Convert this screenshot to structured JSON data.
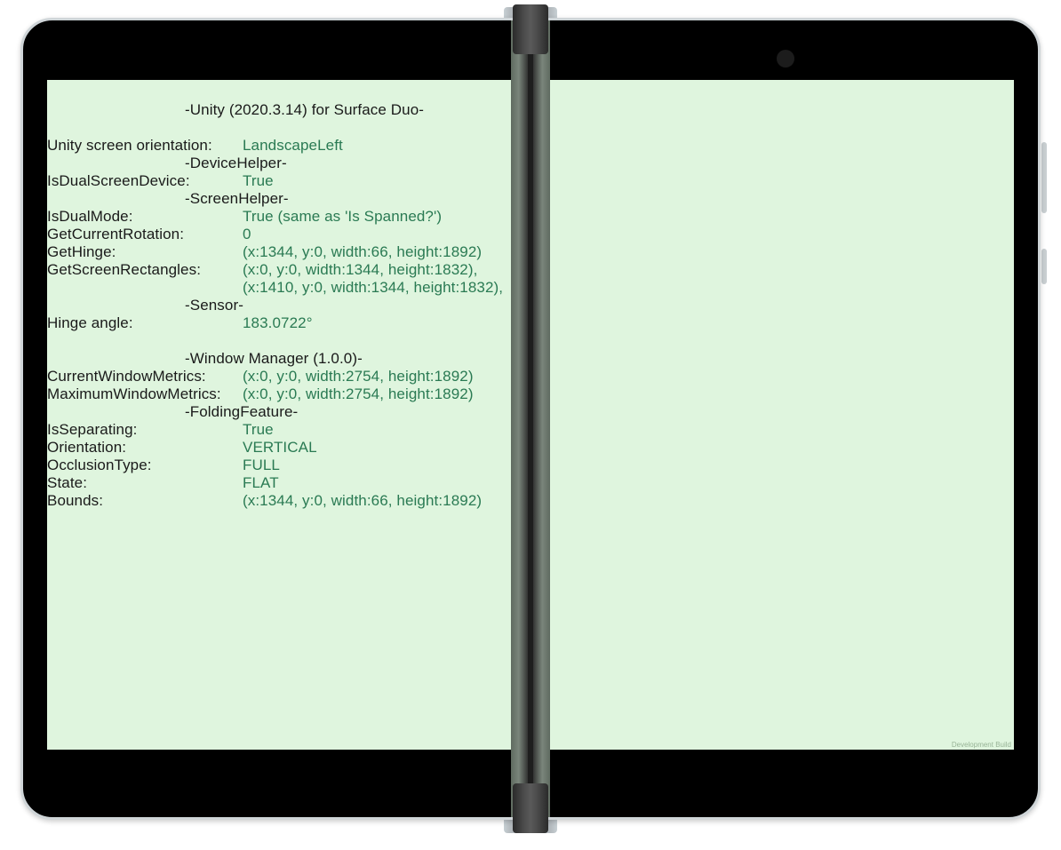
{
  "title": "-Unity (2020.3.14) for Surface Duo-",
  "orientation": {
    "label": "Unity screen orientation:",
    "value": "LandscapeLeft"
  },
  "deviceHelper": {
    "header": "-DeviceHelper-",
    "isDualScreen": {
      "label": "IsDualScreenDevice:",
      "value": "True"
    }
  },
  "screenHelper": {
    "header": "-ScreenHelper-",
    "isDualMode": {
      "label": "IsDualMode:",
      "value": "True    (same as 'Is Spanned?')"
    },
    "getCurrentRotation": {
      "label": "GetCurrentRotation:",
      "value": "0"
    },
    "getHinge": {
      "label": "GetHinge:",
      "value": "(x:1344, y:0, width:66, height:1892)"
    },
    "getScreenRectangles": {
      "label": "GetScreenRectangles:",
      "value1": "(x:0, y:0, width:1344, height:1832),",
      "value2": "(x:1410, y:0, width:1344, height:1832),"
    }
  },
  "sensor": {
    "header": "-Sensor-",
    "hingeAngle": {
      "label": "Hinge angle:",
      "value": "183.0722°"
    }
  },
  "windowManager": {
    "header": "-Window Manager (1.0.0)-",
    "currentWindowMetrics": {
      "label": "CurrentWindowMetrics:",
      "value": "(x:0, y:0, width:2754, height:1892)"
    },
    "maximumWindowMetrics": {
      "label": "MaximumWindowMetrics:",
      "value": "(x:0, y:0, width:2754, height:1892)"
    }
  },
  "foldingFeature": {
    "header": "-FoldingFeature-",
    "isSeparating": {
      "label": "IsSeparating:",
      "value": "True"
    },
    "orientation": {
      "label": "Orientation:",
      "value": "VERTICAL"
    },
    "occlusionType": {
      "label": "OcclusionType:",
      "value": "FULL"
    },
    "state": {
      "label": "State:",
      "value": "FLAT"
    },
    "bounds": {
      "label": "Bounds:",
      "value": "(x:1344, y:0, width:66, height:1892)"
    }
  },
  "devBuildTag": "Development Build"
}
